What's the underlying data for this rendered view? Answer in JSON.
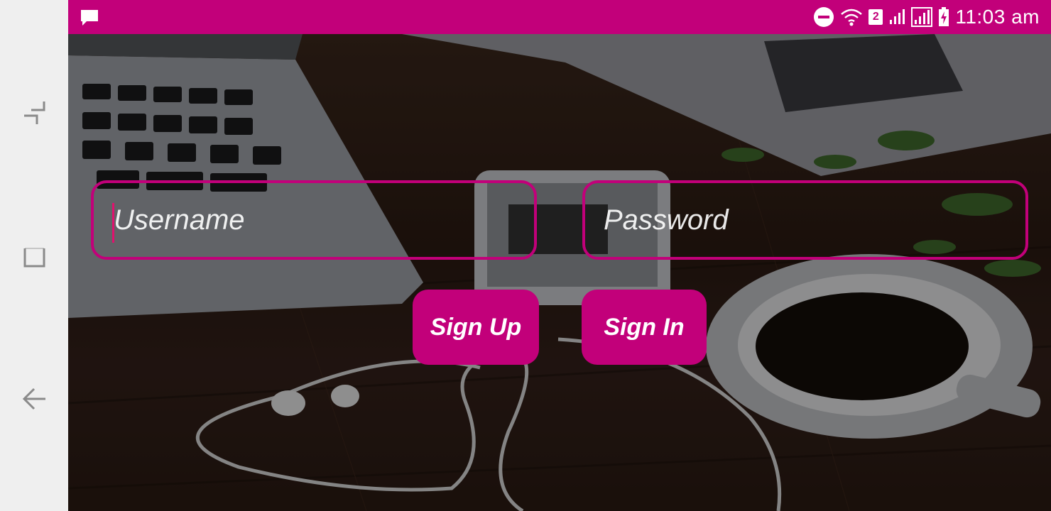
{
  "status_bar": {
    "time": "11:03 am",
    "sim_badge": "2",
    "icons": [
      "message-icon",
      "do-not-disturb-icon",
      "wifi-icon",
      "signal-icon",
      "signal-icon",
      "battery-charging-icon"
    ],
    "color": "#c2007a"
  },
  "navbar": {
    "buttons": [
      "recent-apps-icon",
      "home-icon",
      "back-icon"
    ]
  },
  "login": {
    "username_placeholder": "Username",
    "password_placeholder": "Password",
    "signup_label": "Sign Up",
    "signin_label": "Sign In",
    "accent_color": "#c2007a"
  }
}
